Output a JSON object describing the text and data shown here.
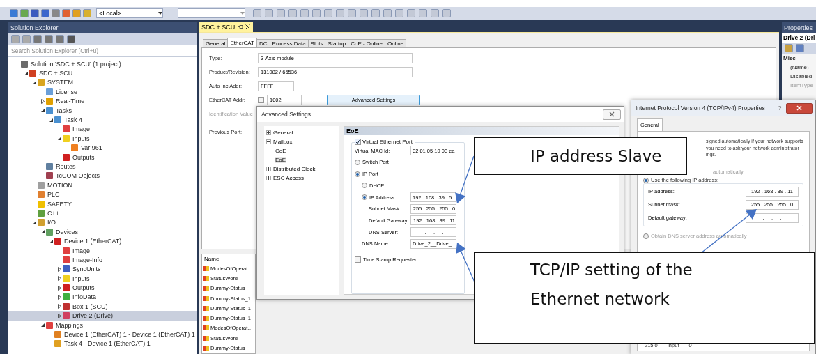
{
  "toolbar": {
    "target_combo": "<Local>"
  },
  "solution_explorer": {
    "title": "Solution Explorer",
    "search_placeholder": "Search Solution Explorer (Ctrl+ü)",
    "tree": [
      {
        "label": "Solution 'SDC + SCU' (1 project)",
        "color": "#6b6b6b",
        "selected": false,
        "children": [
          {
            "label": "SDC + SCU",
            "color": "#d04020",
            "selected": false,
            "expanded": true,
            "children": [
              {
                "label": "SYSTEM",
                "color": "#d9a520",
                "selected": false,
                "expanded": true,
                "children": [
                  {
                    "label": "License",
                    "color": "#6a9fd8",
                    "selected": false
                  },
                  {
                    "label": "Real-Time",
                    "color": "#e0a000",
                    "selected": false,
                    "expanded": false
                  },
                  {
                    "label": "Tasks",
                    "color": "#4a90d0",
                    "selected": false,
                    "expanded": true,
                    "children": [
                      {
                        "label": "Task 4",
                        "color": "#4a90d0",
                        "selected": false,
                        "expanded": true,
                        "children": [
                          {
                            "label": "Image",
                            "color": "#e04040",
                            "selected": false
                          },
                          {
                            "label": "Inputs",
                            "color": "#f0d020",
                            "selected": false,
                            "expanded": true,
                            "children": [
                              {
                                "label": "Var 961",
                                "color": "#f08020",
                                "selected": false
                              }
                            ]
                          },
                          {
                            "label": "Outputs",
                            "color": "#d02020",
                            "selected": false
                          }
                        ]
                      }
                    ]
                  },
                  {
                    "label": "Routes",
                    "color": "#6080a0",
                    "selected": false
                  },
                  {
                    "label": "TcCOM Objects",
                    "color": "#a04050",
                    "selected": false
                  }
                ]
              },
              {
                "label": "MOTION",
                "color": "#a0a0a0",
                "selected": false
              },
              {
                "label": "PLC",
                "color": "#e08030",
                "selected": false
              },
              {
                "label": "SAFETY",
                "color": "#f0c000",
                "selected": false
              },
              {
                "label": "C++",
                "color": "#60a040",
                "selected": false
              },
              {
                "label": "I/O",
                "color": "#d0a030",
                "selected": false,
                "expanded": true,
                "children": [
                  {
                    "label": "Devices",
                    "color": "#60a060",
                    "selected": false,
                    "expanded": true,
                    "children": [
                      {
                        "label": "Device 1 (EtherCAT)",
                        "color": "#d02020",
                        "selected": false,
                        "expanded": true,
                        "children": [
                          {
                            "label": "Image",
                            "color": "#e04040",
                            "selected": false
                          },
                          {
                            "label": "Image-Info",
                            "color": "#e04040",
                            "selected": false
                          },
                          {
                            "label": "SyncUnits",
                            "color": "#4060c0",
                            "selected": false,
                            "expanded": false
                          },
                          {
                            "label": "Inputs",
                            "color": "#f0d020",
                            "selected": false,
                            "expanded": false
                          },
                          {
                            "label": "Outputs",
                            "color": "#d02020",
                            "selected": false,
                            "expanded": false
                          },
                          {
                            "label": "InfoData",
                            "color": "#40b040",
                            "selected": false,
                            "expanded": false
                          },
                          {
                            "label": "Box 1 (SCU)",
                            "color": "#c03030",
                            "selected": false,
                            "expanded": false
                          },
                          {
                            "label": "Drive 2 (Drive)",
                            "color": "#d04060",
                            "selected": true,
                            "expanded": false
                          }
                        ]
                      }
                    ]
                  },
                  {
                    "label": "Mappings",
                    "color": "#e04040",
                    "selected": false,
                    "expanded": true,
                    "children": [
                      {
                        "label": "Device 1 (EtherCAT) 1 - Device 1 (EtherCAT) 1",
                        "color": "#e08020",
                        "selected": false
                      },
                      {
                        "label": "Task 4 - Device 1 (EtherCAT) 1",
                        "color": "#e0a020",
                        "selected": false
                      }
                    ]
                  }
                ]
              }
            ]
          }
        ]
      }
    ]
  },
  "document": {
    "tab": "SDC + SCU",
    "tabs": [
      {
        "label": "General",
        "selected": false
      },
      {
        "label": "EtherCAT",
        "selected": true
      },
      {
        "label": "DC",
        "selected": false
      },
      {
        "label": "Process Data",
        "selected": false
      },
      {
        "label": "Slots",
        "selected": false
      },
      {
        "label": "Startup",
        "selected": false
      },
      {
        "label": "CoE - Online",
        "selected": false
      },
      {
        "label": "Online",
        "selected": false
      }
    ],
    "fields": [
      {
        "kind": "wide",
        "label": "Type:",
        "value": "3-Axis-module"
      },
      {
        "kind": "wide",
        "label": "Product/Revision:",
        "value": "131082 / 65536"
      },
      {
        "kind": "short",
        "label": "Auto Inc Addr:",
        "value": "FFFF"
      },
      {
        "kind": "spin",
        "label": "EtherCAT Addr:",
        "value": "1002",
        "checked": false,
        "button": "Advanced Settings"
      },
      {
        "kind": "disabled",
        "label": "Identification Value"
      },
      {
        "kind": "label",
        "label": "Previous Port:"
      }
    ],
    "name_list": {
      "header": "Name",
      "rows": [
        "ModesOfOperat…",
        "StatusWord",
        "Dummy-Status",
        "Dummy-Status_1",
        "Dummy-Status_1",
        "Dummy-Status_1",
        "ModesOfOperat…",
        "StatusWord",
        "Dummy-Status"
      ]
    }
  },
  "advanced_settings": {
    "title": "Advanced Settings",
    "tree": [
      {
        "label": "General",
        "expanded": false,
        "selected": false
      },
      {
        "label": "Mailbox",
        "expanded": true,
        "selected": false,
        "children": [
          {
            "label": "CoE",
            "selected": false
          },
          {
            "label": "EoE",
            "selected": true
          }
        ]
      },
      {
        "label": "Distributed Clock",
        "expanded": false,
        "selected": false
      },
      {
        "label": "ESC Access",
        "expanded": false,
        "selected": false
      }
    ],
    "eoe": {
      "header": "EoE",
      "virtual_port": {
        "label": "Virtual Ethernet Port",
        "checked": true
      },
      "rows": [
        {
          "kind": "field",
          "label": "Virtual MAC Id:",
          "value": "02 01 05 10 03 ea"
        },
        {
          "kind": "radio",
          "label": "Switch Port",
          "selected": false
        },
        {
          "kind": "radio",
          "label": "IP Port",
          "selected": true
        },
        {
          "kind": "subradio",
          "label": "DHCP",
          "selected": false
        },
        {
          "kind": "radio_field",
          "label": "IP Address",
          "selected": true,
          "value": "192 . 168 . 39 . 5"
        },
        {
          "kind": "subfield",
          "label": "Subnet Mask:",
          "value": "255 . 255 . 255 . 0"
        },
        {
          "kind": "subfield",
          "label": "Default Gateway:",
          "value": "192 . 168 . 39 . 11"
        },
        {
          "kind": "subfield",
          "label": "DNS Server:",
          "value": ".     .     ."
        },
        {
          "kind": "field",
          "label": "DNS Name:",
          "value": "Drive_2__Drive_"
        },
        {
          "kind": "check",
          "label": "Time Stamp Requested",
          "checked": false
        }
      ]
    }
  },
  "ipv4_dialog": {
    "title": "Internet Protocol Version 4 (TCP/IPv4) Properties",
    "help": "?",
    "tab": "General",
    "intro_lines": [
      "signed automatically if your network supports",
      "you need to ask your network administrator",
      "ings."
    ],
    "partial_option": "automatically",
    "option": {
      "label": "Use the following IP address:",
      "selected": true
    },
    "fields": [
      {
        "label": "IP address:",
        "value": "192 . 168 . 39 . 11"
      },
      {
        "label": "Subnet mask:",
        "value": "255 . 255 . 255 . 0"
      },
      {
        "label": "Default gateway:",
        "value": ".     .     ."
      }
    ],
    "dns_option": {
      "label": "Obtain DNS server address automatically",
      "selected": false,
      "disabled": true
    },
    "list_row": [
      "215.0",
      "Input",
      "0"
    ]
  },
  "properties": {
    "title": "Properties",
    "object": "Drive 2 (Dri",
    "group": "Misc",
    "rows": [
      {
        "label": "(Name)",
        "disabled": false
      },
      {
        "label": "Disabled",
        "disabled": false
      },
      {
        "label": "ItemType",
        "disabled": true
      }
    ]
  },
  "callouts": [
    {
      "text": "IP address Slave"
    },
    {
      "text": "TCP/IP setting of the Ethernet network"
    }
  ]
}
